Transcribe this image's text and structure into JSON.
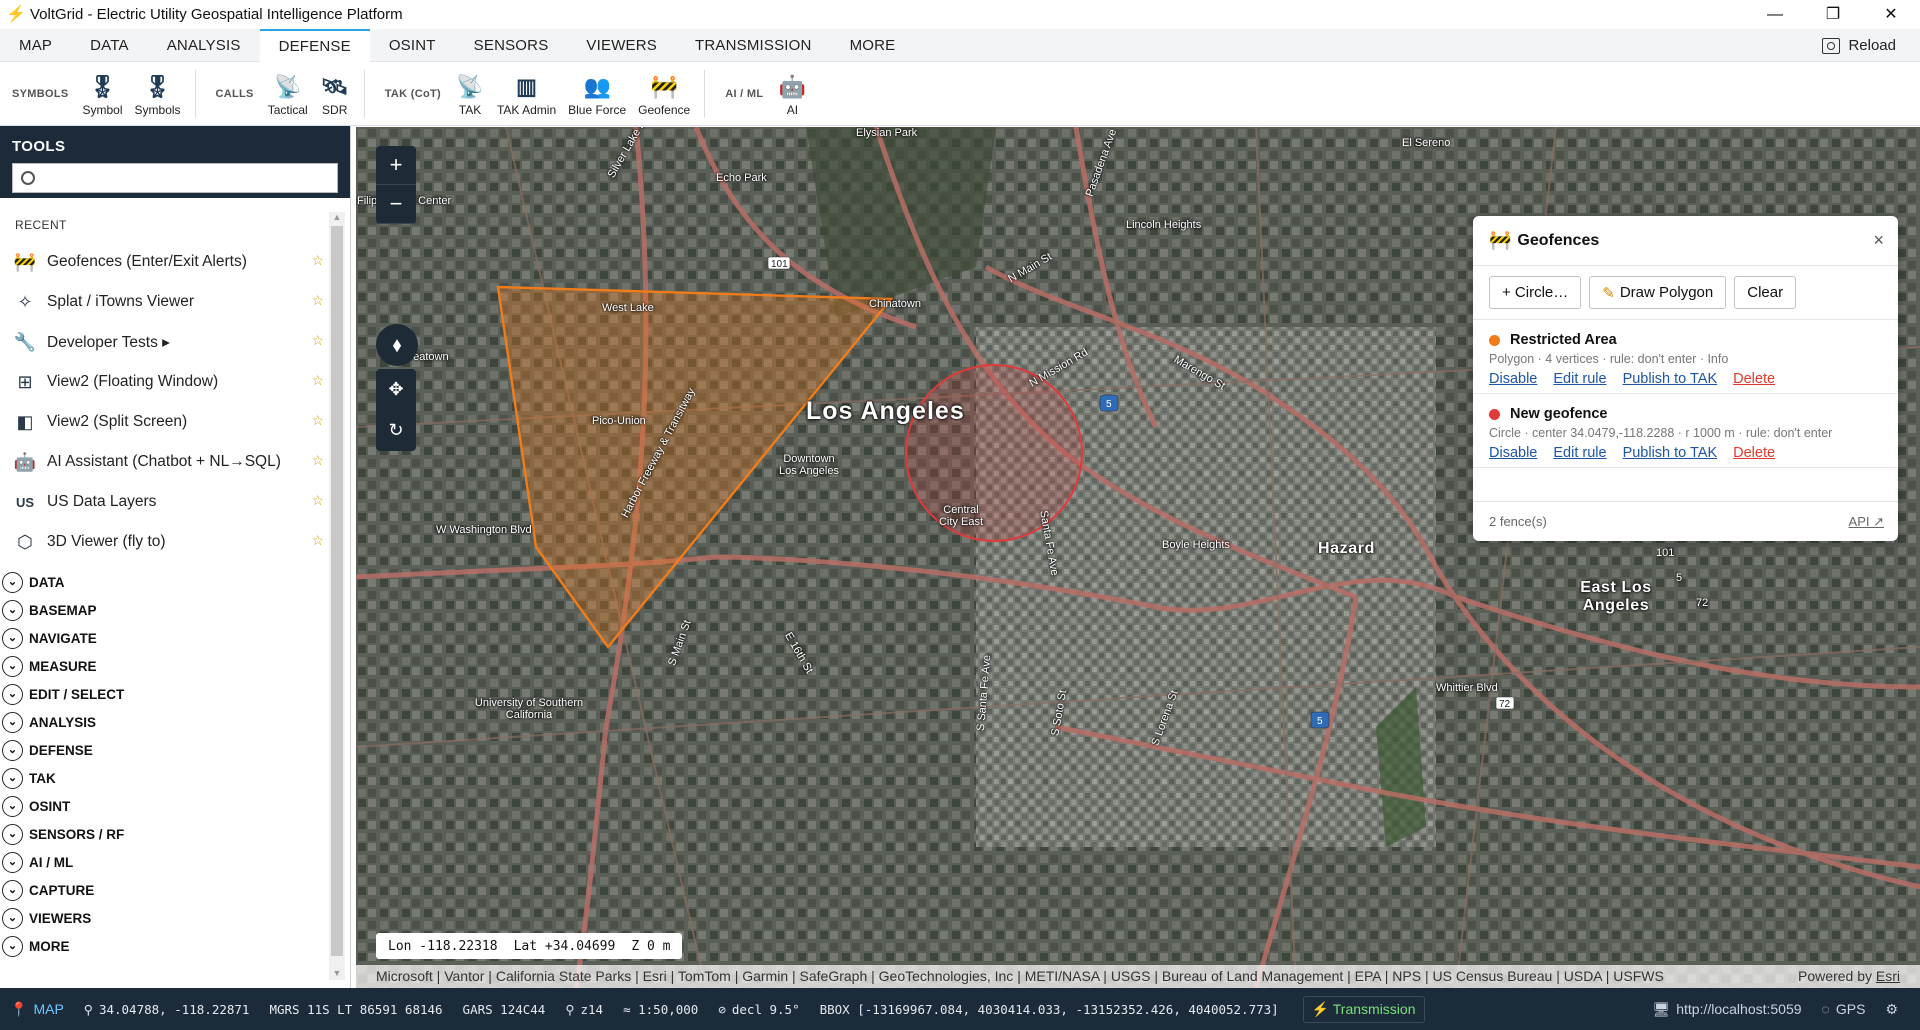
{
  "window": {
    "title": "VoltGrid - Electric Utility Geospatial Intelligence Platform",
    "controls": [
      "—",
      "❐",
      "✕"
    ]
  },
  "menu": {
    "tabs": [
      "MAP",
      "DATA",
      "ANALYSIS",
      "DEFENSE",
      "OSINT",
      "SENSORS",
      "VIEWERS",
      "TRANSMISSION",
      "MORE"
    ],
    "active": "DEFENSE",
    "reload": "Reload"
  },
  "ribbon": {
    "symbols_label": "SYMBOLS",
    "symbol": "Symbol",
    "symbols": "Symbols",
    "calls_label": "CALLS",
    "tactical": "Tactical",
    "sdr": "SDR",
    "tak_label": "TAK (CoT)",
    "tak": "TAK",
    "tak_admin": "TAK Admin",
    "blue_force": "Blue Force",
    "geofence": "Geofence",
    "ai_label": "AI / ML",
    "ai": "AI"
  },
  "sidebar": {
    "title": "TOOLS",
    "search_placeholder": "",
    "recent_label": "RECENT",
    "recent": [
      {
        "label": "Geofences (Enter/Exit Alerts)",
        "icon": "geofence-icon"
      },
      {
        "label": "Splat / iTowns Viewer",
        "icon": "splat-icon"
      },
      {
        "label": "Developer Tests ▸",
        "icon": "wrench-icon"
      },
      {
        "label": "View2 (Floating Window)",
        "icon": "grid-icon"
      },
      {
        "label": "View2 (Split Screen)",
        "icon": "split-icon"
      },
      {
        "label": "AI Assistant (Chatbot + NL→SQL)",
        "icon": "robot-icon"
      },
      {
        "label": "US Data Layers",
        "icon": "us-icon",
        "icon_text": "US"
      },
      {
        "label": "3D Viewer (fly to)",
        "icon": "cube-icon"
      }
    ],
    "sections": [
      "DATA",
      "BASEMAP",
      "NAVIGATE",
      "MEASURE",
      "EDIT / SELECT",
      "ANALYSIS",
      "DEFENSE",
      "TAK",
      "OSINT",
      "SENSORS / RF",
      "AI / ML",
      "CAPTURE",
      "VIEWERS",
      "MORE"
    ]
  },
  "map": {
    "labels": [
      "Los Angeles",
      "Hazard",
      "East Los Angeles",
      "Elysian Park",
      "Echo Park",
      "Lincoln Heights",
      "West Lake",
      "Chinatown",
      "Koreatown",
      "Pico-Union",
      "Downtown Los Angeles",
      "Central City East",
      "Boyle Heights",
      "Whittier Blvd",
      "W Washington Blvd",
      "University of Southern California",
      "N Main St",
      "N Mission Rd",
      "Marengo St",
      "Pasadena Ave",
      "Silver Lake Blvd",
      "Harbor Freeway & Transitway",
      "S Main St",
      "E 16th St",
      "S Santa Fe Ave",
      "S Soto St",
      "S Lorena St",
      "Santa Fe Ave",
      "El Sereno",
      "Filipinotown Center",
      "101",
      "5",
      "72"
    ],
    "coords": {
      "lon": "Lon -118.22318",
      "lat": "Lat +34.04699",
      "z": "Z 0 m"
    },
    "attribution": "Microsoft | Vantor | California State Parks | Esri | TomTom | Garmin | SafeGraph | GeoTechnologies, Inc | METI/NASA | USGS | Bureau of Land Management | EPA | NPS | US Census Bureau | USDA | USFWS",
    "powered": "Powered by",
    "powered_link": "Esri"
  },
  "geofences": {
    "title": "Geofences",
    "buttons": {
      "circle": "+ Circle…",
      "polygon": "Draw Polygon",
      "clear": "Clear"
    },
    "fences": [
      {
        "name": "Restricted Area",
        "color": "#f07c1a",
        "meta": "Polygon · 4 vertices · rule: don't enter · Info",
        "actions": [
          "Disable",
          "Edit rule",
          "Publish to TAK",
          "Delete"
        ]
      },
      {
        "name": "New geofence",
        "color": "#e03a3a",
        "meta": "Circle · center 34.0479,-118.2288 · r 1000 m · rule: don't enter",
        "actions": [
          "Disable",
          "Edit rule",
          "Publish to TAK",
          "Delete"
        ]
      }
    ],
    "count": "2 fence(s)",
    "api": "API ↗"
  },
  "status": {
    "mode": "MAP",
    "latlon": "34.04788, -118.22871",
    "mgrs": "MGRS 11S LT 86591 68146",
    "gars": "GARS 124C44",
    "zoom": "z14",
    "scale": "≈ 1:50,000",
    "decl": "decl 9.5°",
    "bbox": "BBOX [-13169967.084, 4030414.033, -13152352.426, 4040052.773]",
    "transmission": "Transmission",
    "url": "http://localhost:5059",
    "gps": "GPS"
  },
  "colors": {
    "accent": "#2aa3e0",
    "header": "#1c2a3a",
    "polygon": "#f07c1a",
    "circle": "#e03a3a",
    "link": "#1d55a6"
  }
}
